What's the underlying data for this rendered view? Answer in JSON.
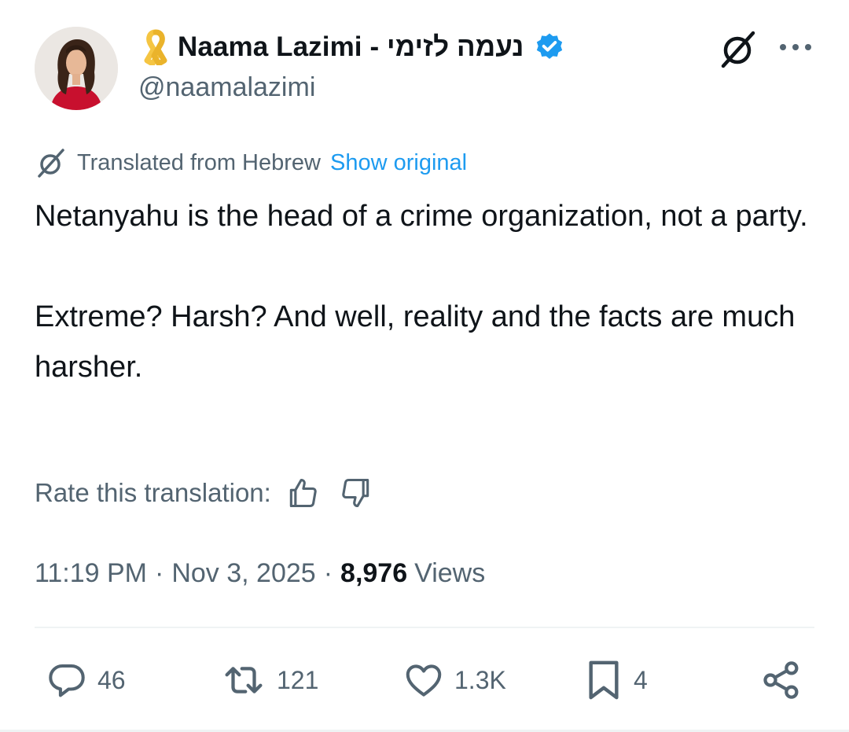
{
  "author": {
    "display_name": "Naama Lazimi - נעמה לזימי",
    "handle": "@naamalazimi",
    "verified": true,
    "badge_icon": "yellow-ribbon-icon",
    "badge_color": "#f5c542",
    "verified_color": "#1d9bf0"
  },
  "header_actions": {
    "grok_icon": "grok-icon",
    "more_icon": "more-horizontal-icon"
  },
  "translation": {
    "label": "Translated from Hebrew",
    "show_original": "Show original",
    "rate_label": "Rate this translation:"
  },
  "tweet": {
    "paragraphs": [
      "Netanyahu is the head of a crime organization, not a party.",
      "Extreme? Harsh? And well, reality and the facts are much harsher."
    ]
  },
  "meta": {
    "time": "11:19 PM",
    "separator": "·",
    "date": "Nov 3, 2025",
    "views_count": "8,976",
    "views_label": "Views"
  },
  "actions": {
    "replies": "46",
    "reposts": "121",
    "likes": "1.3K",
    "bookmarks": "4"
  },
  "colors": {
    "text_primary": "#0f1419",
    "text_secondary": "#536471",
    "link": "#1d9bf0",
    "divider": "#eff3f4"
  }
}
